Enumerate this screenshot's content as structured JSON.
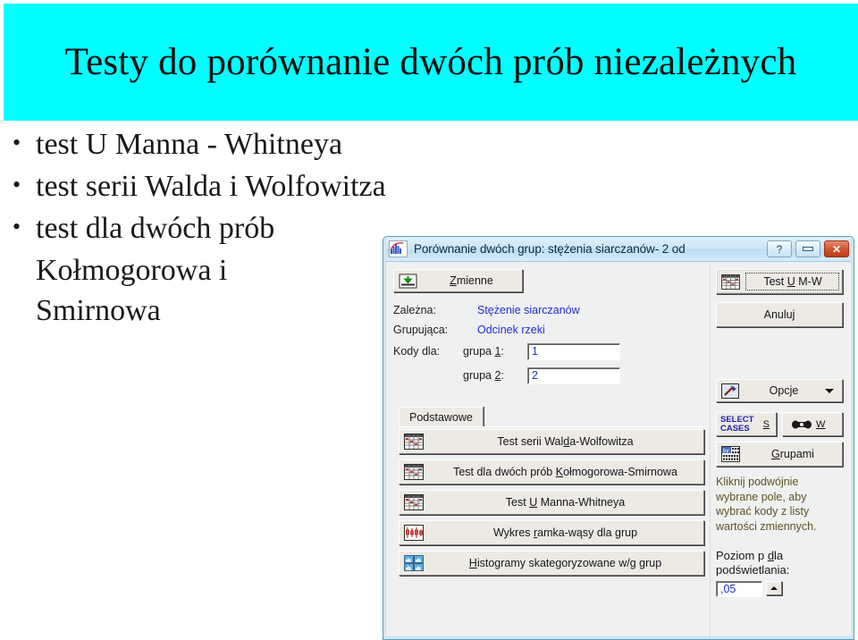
{
  "slide": {
    "title": "Testy do porównanie dwóch prób niezależnych",
    "title_line1": "Testy do porównanie dwóch prób",
    "title_line2": "niezależnych",
    "banner_color": "#00FFFF",
    "bullets": [
      {
        "text": "test U Manna - Whitneya"
      },
      {
        "text": "test serii Walda i Wolfowitza"
      },
      {
        "text": "test dla dwóch prób",
        "continuation": [
          "Kołmogorowa i",
          "Smirnowa"
        ]
      }
    ]
  },
  "dialog": {
    "titlebar": {
      "title": "Porównanie dwóch grup: stężenia siarczanów- 2 od",
      "icon": "chart-histogram-icon",
      "help_label": "?",
      "minimize_label": "",
      "close_label": "✕"
    },
    "variables_button": {
      "label": "Zmienne",
      "icon": "variables-icon"
    },
    "fields": [
      {
        "label": "Zależna:",
        "value": "Stężenie siarczanów"
      },
      {
        "label": "Grupująca:",
        "value": "Odcinek rzeki"
      }
    ],
    "codes": {
      "label": "Kody dla:",
      "group1_label": "grupa 1:",
      "group1_value": "1",
      "group2_label": "grupa 2:",
      "group2_value": "2"
    },
    "tabs": [
      {
        "label": "Podstawowe",
        "selected": true
      }
    ],
    "analysis_buttons": [
      {
        "label": "Test serii Walda-Wolfowitza",
        "icon": "spreadsheet-icon"
      },
      {
        "label": "Test dla dwóch prób Kołmogorowa-Smirnowa",
        "icon": "spreadsheet-icon"
      },
      {
        "label": "Test U Manna-Whitneya",
        "icon": "spreadsheet-icon"
      },
      {
        "label": "Wykres ramka-wąsy dla grup",
        "icon": "boxplot-icon"
      },
      {
        "label": "Histogramy skategoryzowane w/g grup",
        "icon": "histogram-grid-icon"
      }
    ],
    "ok_button": {
      "label": "Test U M-W",
      "icon": "spreadsheet-icon"
    },
    "cancel_button": {
      "label": "Anuluj"
    },
    "options_button": {
      "label": "Opcje",
      "icon": "tools-icon"
    },
    "select_cases_button": {
      "label_line1": "SELECT",
      "label_line2": "CASES",
      "shortcut": "S"
    },
    "weight_button": {
      "shortcut": "W",
      "icon": "weight-icon"
    },
    "groups_button": {
      "label": "Grupami",
      "icon": "by-groups-icon"
    },
    "hint_lines": [
      "Kliknij podwójnie",
      "wybrane pole, aby",
      "wybrać kody z listy",
      "wartości  zmiennych."
    ],
    "p_level": {
      "label_line1": "Poziom p dla",
      "label_line2": "podświetlania:",
      "value": ",05"
    }
  }
}
